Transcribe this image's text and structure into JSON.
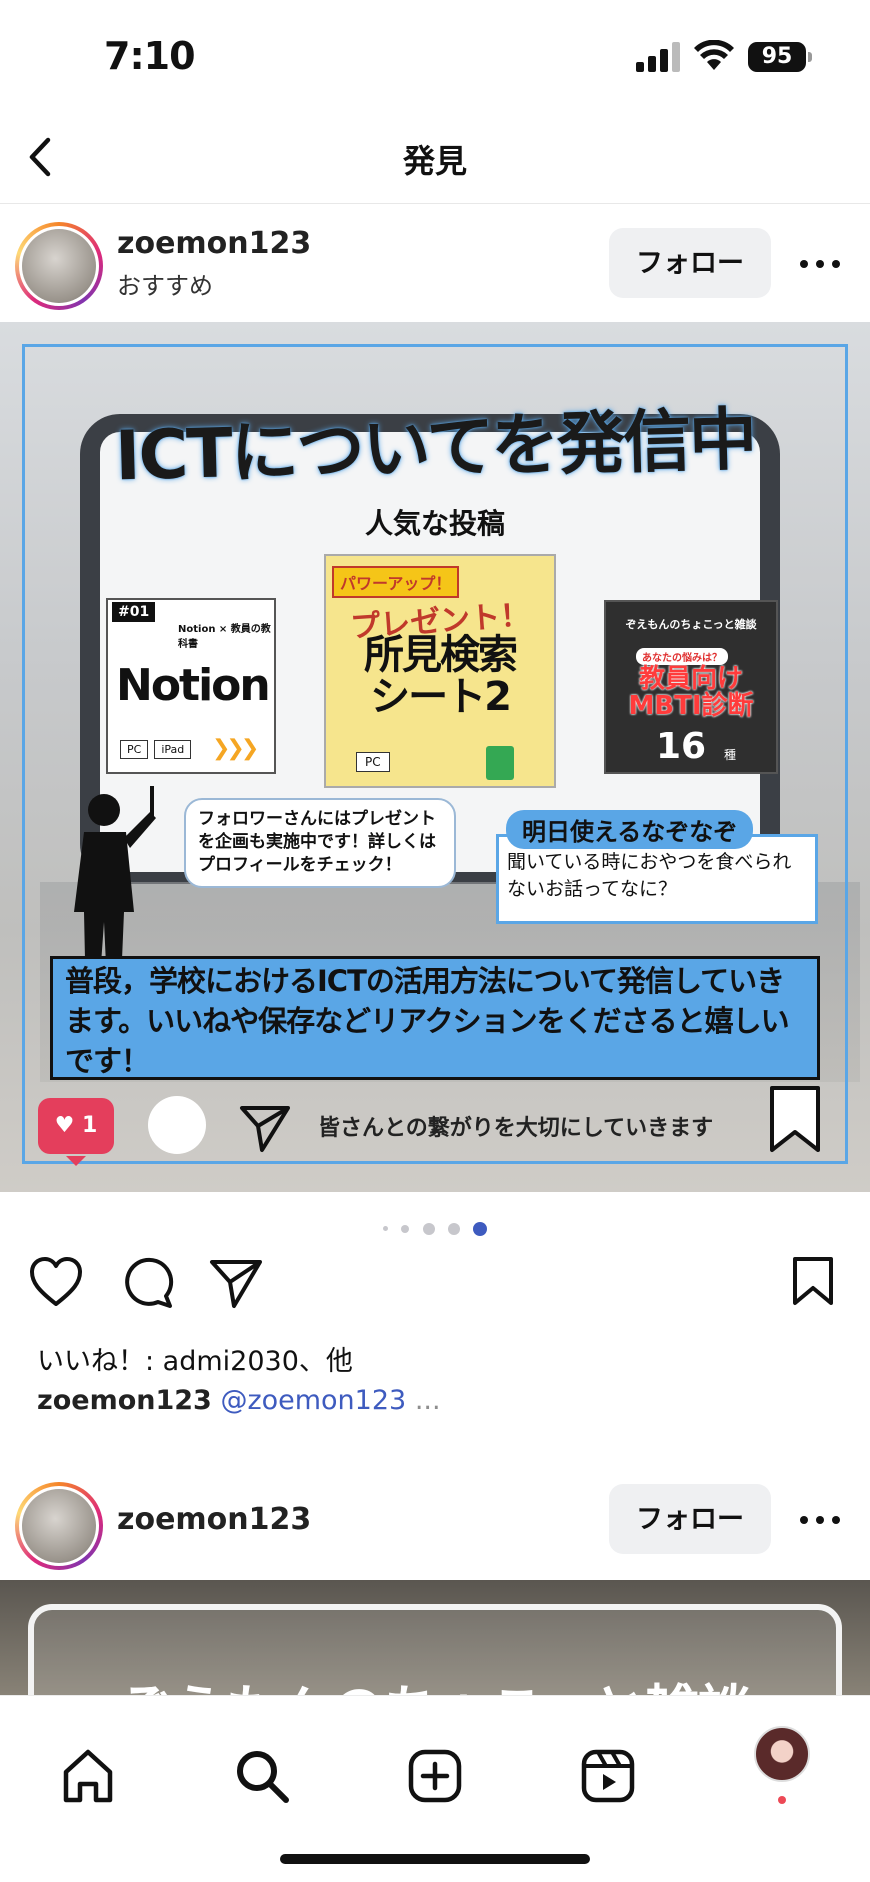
{
  "status_bar": {
    "time": "7:10",
    "battery": "95"
  },
  "nav": {
    "title": "発見"
  },
  "post1": {
    "username": "zoemon123",
    "subtitle": "おすすめ",
    "follow_label": "フォロー",
    "image": {
      "title": "ICTについてを発信中",
      "popular": "人気な投稿",
      "notion_tag": "#01",
      "notion_subtitle": "Notion × 教員の教科書",
      "notion_big": "Notion",
      "notion_chips": [
        "PC",
        "iPad"
      ],
      "present_badge": "パワーアップ！",
      "present_title": "プレゼント！",
      "present_main_1": "所見検索",
      "present_main_2": "シート2",
      "present_chip": "PC",
      "mbti_top": "ぞえもんのちょこっと雑談",
      "mbti_question": "あなたの悩みは？",
      "mbti_main_1": "教員向け",
      "mbti_main_2": "MBTI診断",
      "mbti_num": "16",
      "mbti_unit": "種",
      "speech": "フォロワーさんにはプレゼントを企画も実施中です！詳しくはプロフィールをチェック！",
      "quiz_title": "明日使えるなぞなぞ",
      "quiz_text": "聞いている時におやつを食べられないお話ってなに？",
      "banner": "普段，学校におけるICTの活用方法について発信していきます。いいねや保存などリアクションをくださると嬉しいです！",
      "like_count": "1",
      "bottom_caption": "皆さんとの繋がりを大切にしていきます"
    },
    "carousel": {
      "count": 5,
      "active_index": 4
    },
    "likes_text": "いいね！: admi2030、他",
    "caption": {
      "username": "zoemon123",
      "mention": "@zoemon123",
      "more": "..."
    }
  },
  "post2": {
    "username": "zoemon123",
    "follow_label": "フォロー",
    "image_title": "ぞえもんのちょこっと雑談"
  },
  "icons": {
    "back": "chevron-left-icon",
    "more": "more-horizontal-icon",
    "like": "heart-icon",
    "comment": "comment-icon",
    "share": "send-icon",
    "save": "bookmark-icon",
    "tabs": [
      "home-icon",
      "search-icon",
      "create-icon",
      "reels-icon",
      "profile-avatar"
    ]
  },
  "colors": {
    "accent_blue": "#5aa6e6",
    "like_red": "#e43e5c",
    "mention_blue": "#3e5bbf",
    "notification_dot": "#ed4956"
  }
}
